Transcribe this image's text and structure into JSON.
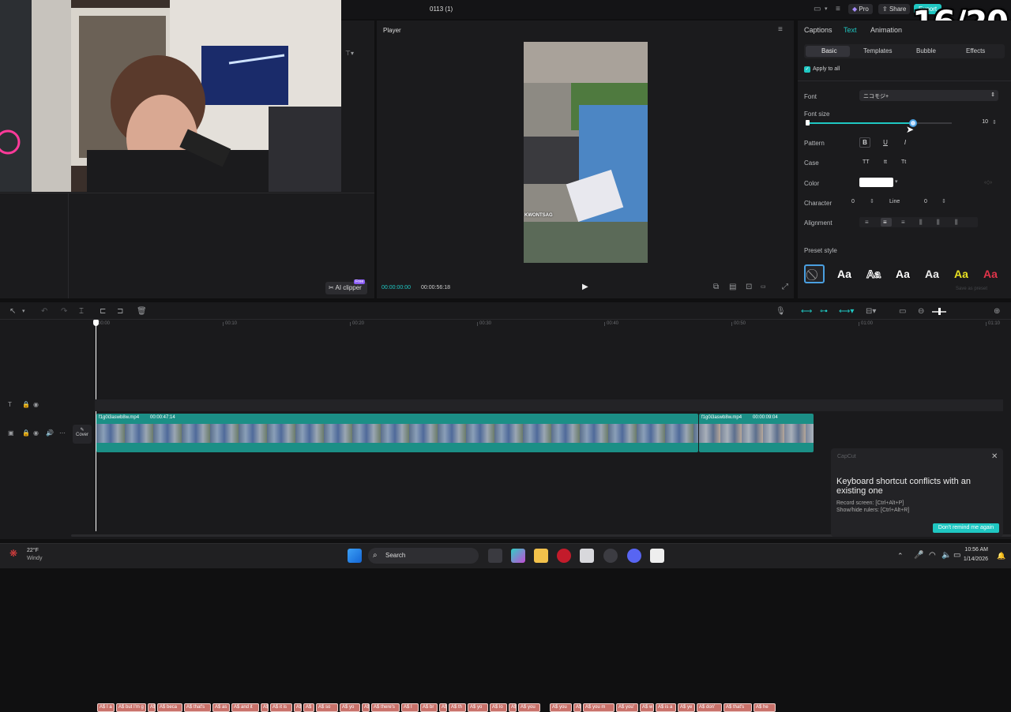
{
  "stream": {
    "counter": "16/20"
  },
  "titlebar": {
    "project_name": "0113 (1)",
    "pro_label": "Pro",
    "share_label": "Share",
    "export_label": "Export"
  },
  "media_panel": {
    "ai_clipper_label": "AI clipper",
    "free_badge": "Free"
  },
  "player": {
    "title": "Player",
    "current_time": "00:00:00:00",
    "total_time": "00:00:56:18",
    "caption_text": "KWONTSAG"
  },
  "inspector": {
    "tabs": [
      "Captions",
      "Text",
      "Animation"
    ],
    "active_tab": "Text",
    "subtabs": [
      "Basic",
      "Templates",
      "Bubble",
      "Effects"
    ],
    "active_subtab": "Basic",
    "apply_to_all": "Apply to all",
    "font_label": "Font",
    "font_value": "ニコモジ+",
    "font_size_label": "Font size",
    "font_size_value": "10",
    "font_size_fraction": 0.73,
    "pattern_label": "Pattern",
    "case_label": "Case",
    "case_options": [
      "TT",
      "tt",
      "Tt"
    ],
    "color_label": "Color",
    "color_value": "#ffffff",
    "character_label": "Character",
    "character_value": "0",
    "line_label": "Line",
    "line_value": "0",
    "alignment_label": "Alignment",
    "preset_label": "Preset style",
    "preset_sample": "Aa",
    "save_preset": "Save as preset"
  },
  "timeline": {
    "ruler": [
      "00:00",
      "00:10",
      "00:20",
      "00:30",
      "00:40",
      "00:50",
      "01:00",
      "01:10"
    ],
    "cover_label": "Cover",
    "clip1_name": "f1g0i3aswb8w.mp4",
    "clip1_duration": "00:00:47:14",
    "clip2_name": "f1g0i3aswb8w.mp4",
    "clip2_duration": "00:00:09:04",
    "captions": [
      "A$ I a",
      "A$ but I'm g",
      "A$",
      "A$ beca",
      "A$ that's",
      "A$ as",
      "A$ and it",
      "A$",
      "A$ it is",
      "A$",
      "A$",
      "A$ so",
      "A$ yo",
      "A$",
      "A$ there's",
      "A$ I",
      "A$ br",
      "A$",
      "A$ th",
      "A$ yo",
      "A$ lo",
      "A$",
      "A$ you",
      "A$ you",
      "A$",
      "A$ you m",
      "A$ you'",
      "A$ w",
      "A$ is a",
      "A$ ye",
      "A$ don'",
      "A$ that's",
      "A$ he"
    ]
  },
  "toast": {
    "app": "CapCut",
    "title": "Keyboard shortcut conflicts with an existing one",
    "line1": "Record screen: [Ctrl+Alt+P]",
    "line2": "Show/hide rulers: [Ctrl+Alt+R]",
    "button": "Don't remind me again"
  },
  "taskbar": {
    "temperature": "22°F",
    "weather": "Windy",
    "search_placeholder": "Search",
    "time": "10:56 AM",
    "date": "1/14/2026"
  },
  "colors": {
    "accent": "#1fc7c2",
    "caption_clip": "#c9726b",
    "video_clip": "#1b8f86",
    "preset_yellow": "#e8e022",
    "preset_red": "#e0344a"
  }
}
